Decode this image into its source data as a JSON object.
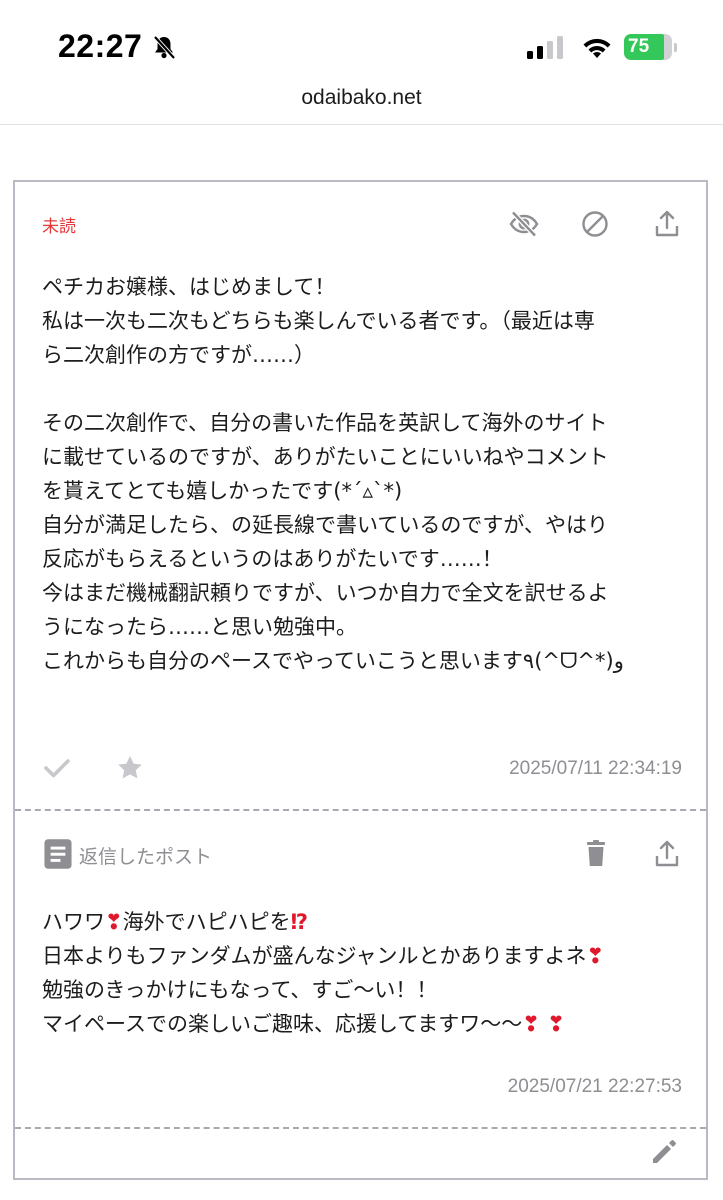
{
  "status_bar": {
    "time": "22:27",
    "battery_level": "75",
    "icons": [
      "bell-slash-icon",
      "cellular-signal-icon",
      "wifi-icon",
      "battery-charging-icon"
    ]
  },
  "browser": {
    "url": "odaibako.net"
  },
  "card": {
    "status_label": "未読",
    "status_color": "#e5383b",
    "header_actions": [
      "eye-slash-icon",
      "block-icon",
      "share-icon"
    ],
    "message_lines": [
      "ペチカお嬢様、はじめまして！",
      "私は一次も二次もどちらも楽しんでいる者です。（最近は専",
      "ら二次創作の方ですが……）",
      "",
      "その二次創作で、自分の書いた作品を英訳して海外のサイト",
      "に載せているのですが、ありがたいことにいいねやコメント",
      "を貰えてとても嬉しかったです(*´▵`*)",
      "自分が満足したら、の延長線で書いているのですが、やはり",
      "反応がもらえるというのはありがたいです……！",
      "今はまだ機械翻訳頼りですが、いつか自力で全文を訳せるよ",
      "うになったら……と思い勉強中。",
      "これからも自分のペースでやっていこうと思います٩(^ᗜ^*)و"
    ],
    "message_actions": [
      "check-icon",
      "star-icon"
    ],
    "message_timestamp": "2025/07/11 22:34:19",
    "reply": {
      "label": "返信したポスト",
      "actions": [
        "trash-icon",
        "share-icon"
      ],
      "line1_a": "ハワワ",
      "line1_mark1": "❣",
      "line1_b": "海外でハピハピを",
      "line1_mark2": "⁉",
      "line2_a": "日本よりもファンダムが盛んなジャンルとかありますよネ",
      "line2_mark": "❣",
      "line3": "勉強のきっかけにもなって、すご〜い！！",
      "line4_a": "マイペースでの楽しいご趣味、応援してますワ〜〜",
      "line4_marks": "❣ ❣",
      "timestamp": "2025/07/21 22:27:53"
    },
    "footer_action": "pencil-icon"
  }
}
